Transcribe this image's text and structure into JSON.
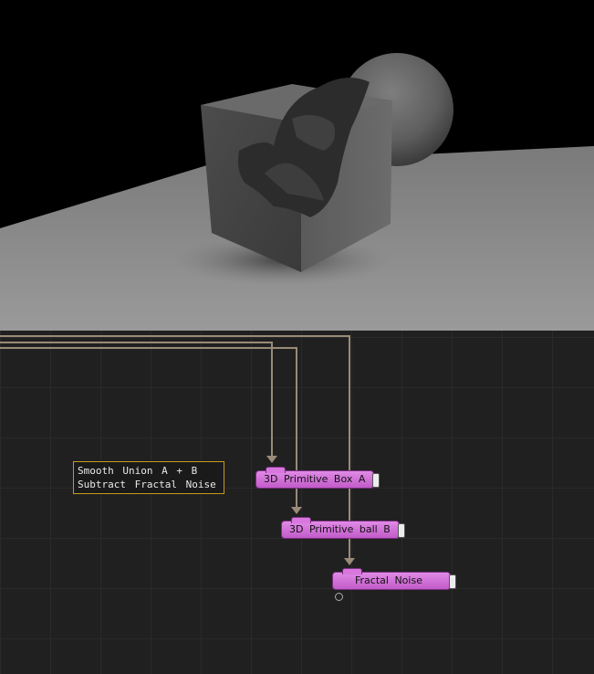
{
  "viewport": {
    "colors": {
      "background": "#000000",
      "floor": "#8a8a8a",
      "object": "#5a5a5a"
    }
  },
  "node_graph": {
    "note": {
      "line1": "Smooth Union A + B",
      "line2": "Subtract Fractal Noise"
    },
    "nodes": [
      {
        "label": "3D Primitive Box A"
      },
      {
        "label": "3D Primitive ball B"
      },
      {
        "label": "Fractal Noise"
      }
    ],
    "colors": {
      "node": "#d170d8",
      "wire": "#9a8a78",
      "note_border": "#c49a1e"
    }
  }
}
